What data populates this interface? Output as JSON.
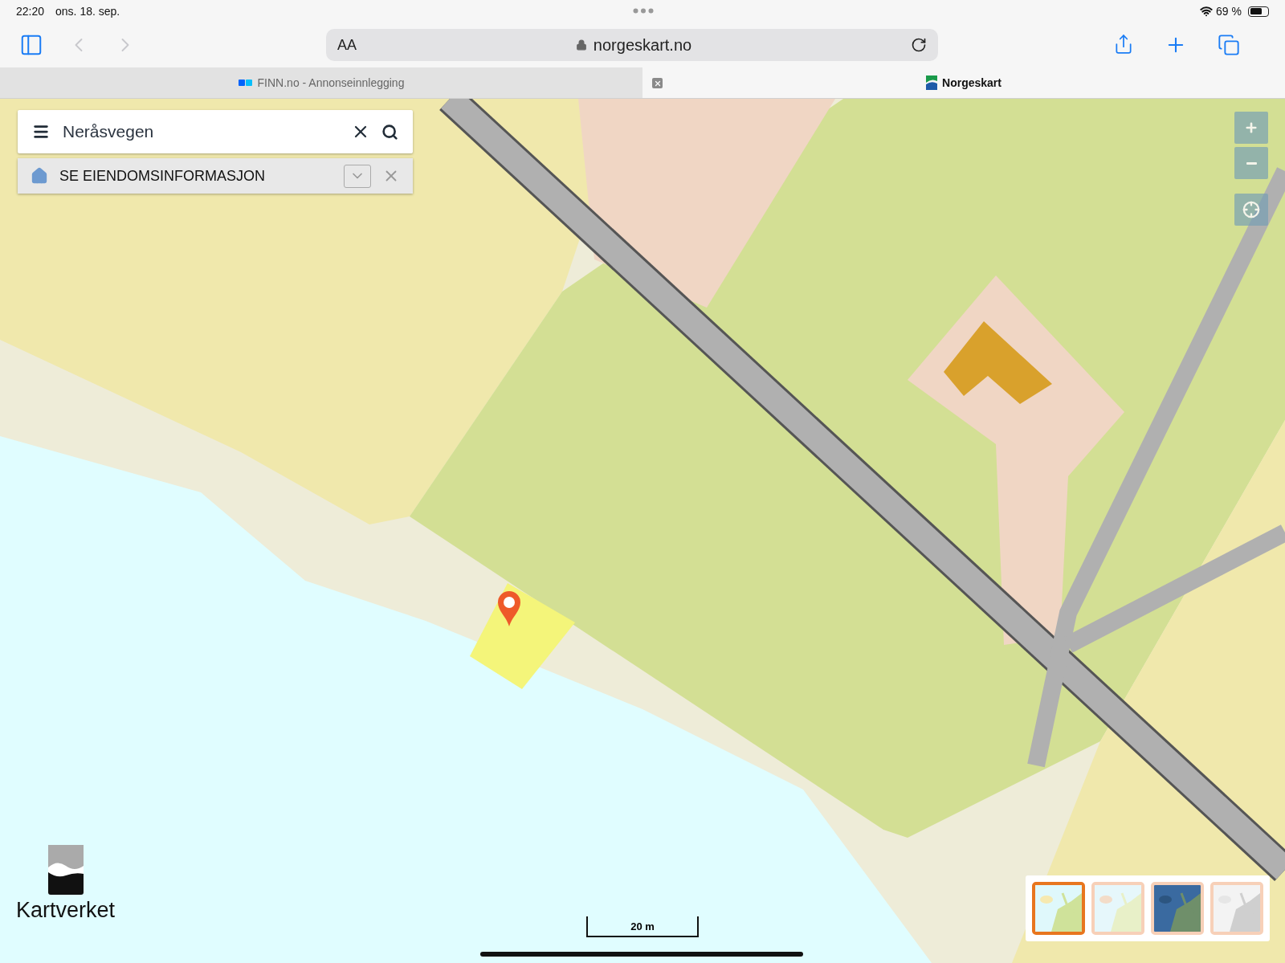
{
  "status_bar": {
    "time": "22:20",
    "date": "ons. 18. sep.",
    "battery": "69 %"
  },
  "toolbar": {
    "text_size": "AA",
    "address": "norgeskart.no"
  },
  "tabs": [
    {
      "label": "FINN.no - Annonseinnlegging",
      "selected": false
    },
    {
      "label": "Norgeskart",
      "selected": true
    }
  ],
  "map": {
    "search": {
      "value": "Neråsvegen"
    },
    "property_bar": {
      "label": "SE EIENDOMSINFORMASJON"
    },
    "logo": "Kartverket",
    "scale": "20 m",
    "layers": [
      {
        "kind": "picture",
        "selected": true
      },
      {
        "kind": "picture",
        "selected": false
      },
      {
        "kind": "picture",
        "selected": false
      },
      {
        "kind": "picture",
        "selected": false
      }
    ]
  }
}
